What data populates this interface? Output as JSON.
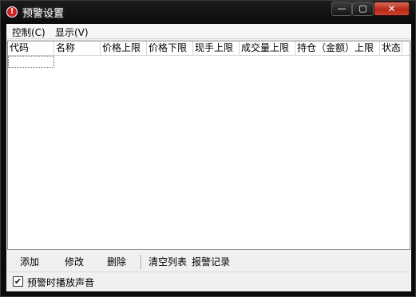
{
  "window": {
    "title": "预警设置",
    "icon": "alert-icon",
    "buttons": {
      "minimize": "—",
      "maximize": "▢",
      "close": "✕"
    }
  },
  "menu": {
    "items": [
      {
        "label": "控制(C)"
      },
      {
        "label": "显示(V)"
      }
    ]
  },
  "table": {
    "columns": [
      "代码",
      "名称",
      "价格上限",
      "价格下限",
      "现手上限",
      "成交量上限",
      "持仓（金额）上限",
      "状态"
    ],
    "rows": []
  },
  "toolbar": {
    "add": "添加",
    "edit": "修改",
    "delete": "删除",
    "clear": "清空列表",
    "log": "报警记录"
  },
  "options": {
    "sound_label": "预警时播放声音",
    "sound_checked": true
  },
  "colors": {
    "titlebar": "#0a0a0a",
    "close_button": "#c7442f",
    "client_bg": "#f0f0f0"
  }
}
